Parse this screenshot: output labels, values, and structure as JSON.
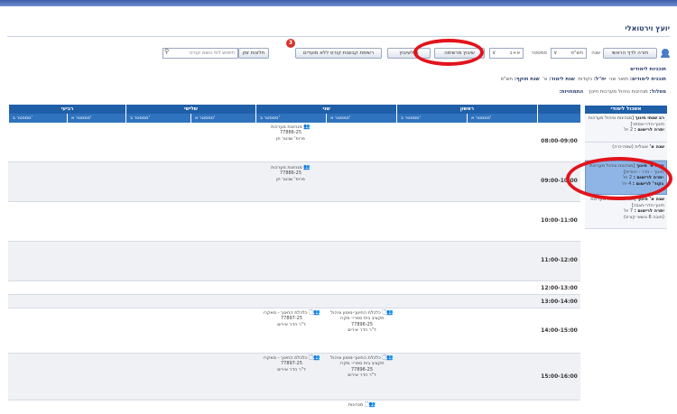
{
  "app": {
    "title": "יועץ וירטואלי"
  },
  "toolbar": {
    "main_button": "חזרה לדף הראשי",
    "year_label": "שנה",
    "year_value": "תש\"פ",
    "semester_label": "סמסטר",
    "semester_value": "א+ב",
    "schedule_button": "שיבוץ מרשימה",
    "manual_button": "ם לשיבוץ",
    "groups_button": "רשימת קבוצות קורס ללא מועדים",
    "badge_count": "3",
    "times_button": "חלונות זמן",
    "search_placeholder": "חיפוש לפי נושא קורס"
  },
  "info": {
    "plans_title": "תוכניות לימודים",
    "plan_line_label": "תוכנית לימודים:",
    "plan_line_value": "תואר שני",
    "credits_label": "יח\"ל:",
    "credits_value": "נקודות",
    "year_label": "שנת לימוד:",
    "year_value": "א'",
    "validity_label": "שנת תוקף:",
    "validity_value": "תש\"פ",
    "track_label": "מסלול:",
    "track_value": "מנהיגות וניהול מערכות חינוך",
    "spec_label": "התמחויות:",
    "spec_value": ""
  },
  "sidebar": {
    "header": "אשכול לימודי",
    "items": [
      {
        "title": "רב שנתי חינוך",
        "desc": "[מנהיגות וניהול מערכות חינוך-הדר-אסתר]",
        "req_label": "יתרה לרישום :",
        "req_value": "2 יח'"
      },
      {
        "title": "שנה א'",
        "desc": "אנגלית (שפה-זרה)",
        "req_label": "",
        "req_value": ""
      },
      {
        "title": "שנה א' חינוך",
        "desc": "[מנהיגות וניהול מערכות חינוך - הדר - יהודית]",
        "req_label": "יתרה לרישום :",
        "req_value": "2 יח'",
        "req2_label": "נקוד' לרישום :",
        "req2_value": "4 יח'"
      },
      {
        "title": "שנה א' חינוך",
        "desc": "[מנהיגות וניהול מערכות חינוך-הדר-חגבה]",
        "req_label": "יתרה לרישום :",
        "req_value": "7 יח'",
        "req2_label": "",
        "req2_value": "(חובה 6 נושאי קורס)"
      }
    ]
  },
  "grid": {
    "days": [
      "ראשון",
      "שני",
      "שלישי",
      "רביעי"
    ],
    "semesters": [
      "סמסטר א'",
      "סמסטר ב'"
    ],
    "times": [
      "08:00-09:00",
      "09:00-10:00",
      "10:00-11:00",
      "11:00-12:00",
      "12:00-13:00",
      "13:00-14:00",
      "14:00-15:00",
      "15:00-16:00"
    ],
    "courses": {
      "c1": {
        "name": "מנהיגות מערכות",
        "code": "77886-25",
        "lecturer": "פרופ' שכטר חן"
      },
      "c2": {
        "name": "מנהיגות מערכות",
        "code": "77886-25",
        "lecturer": "פרופ' שכטר חן"
      },
      "c3": {
        "name": "כלכלת החינוך-מימון וניהול תקציב בית ספרי- מקרו",
        "code": "77896-25",
        "lecturer": "ד\"ר הדר אירים"
      },
      "c4": {
        "name": "כלכלת החינוך - מאקרו",
        "code": "77897-25",
        "lecturer": "ד\"ר הדר אירים"
      },
      "c5": {
        "name": "כלכלת החינוך-מימון וניהול תקציב בית ספרי- מקרו",
        "code": "77896-25",
        "lecturer": "ד\"ר הדר אירים"
      },
      "c6": {
        "name": "כלכלת החינוך - מאקרו",
        "code": "77897-25",
        "lecturer": "ד\"ר הדר אירים"
      },
      "c7": {
        "name": "מנהיגות"
      }
    }
  }
}
